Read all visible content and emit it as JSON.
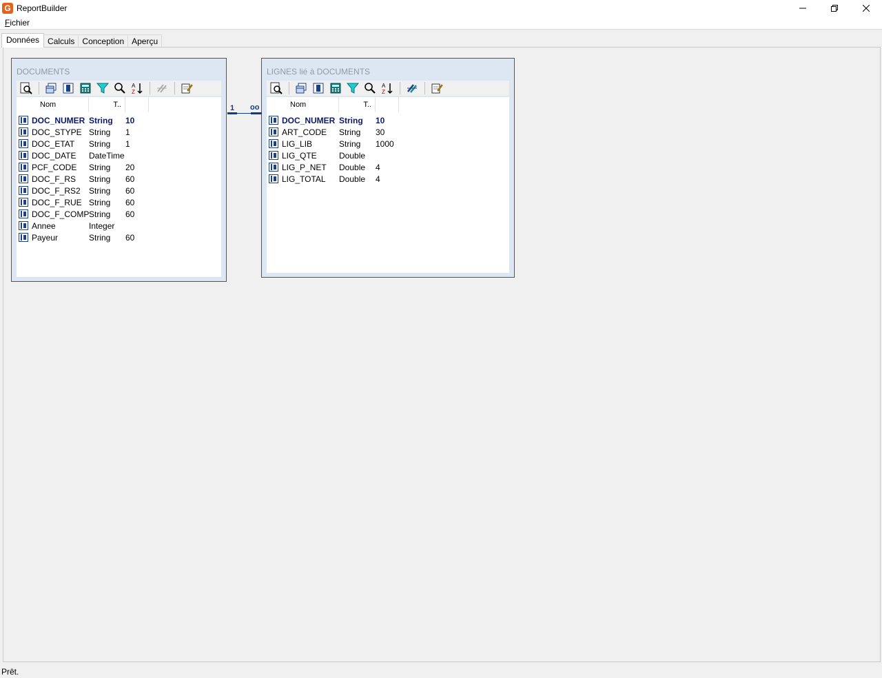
{
  "window": {
    "title": "ReportBuilder",
    "logo_letter": "G"
  },
  "menu": {
    "fichier_mnemonic": "F",
    "fichier_rest": "ichier"
  },
  "tabs": [
    {
      "label": "Données",
      "active": true
    },
    {
      "label": "Calculs",
      "active": false
    },
    {
      "label": "Conception",
      "active": false
    },
    {
      "label": "Aperçu",
      "active": false
    }
  ],
  "tables": {
    "documents": {
      "title": "DOCUMENTS",
      "col_name": "Nom",
      "col_type": "T..",
      "fields": [
        {
          "name": "DOC_NUMER",
          "type": "String",
          "size": "10",
          "pk": true
        },
        {
          "name": "DOC_STYPE",
          "type": "String",
          "size": "1"
        },
        {
          "name": "DOC_ETAT",
          "type": "String",
          "size": "1"
        },
        {
          "name": "DOC_DATE",
          "type": "DateTime",
          "size": ""
        },
        {
          "name": "PCF_CODE",
          "type": "String",
          "size": "20"
        },
        {
          "name": "DOC_F_RS",
          "type": "String",
          "size": "60"
        },
        {
          "name": "DOC_F_RS2",
          "type": "String",
          "size": "60"
        },
        {
          "name": "DOC_F_RUE",
          "type": "String",
          "size": "60"
        },
        {
          "name": "DOC_F_COMP",
          "type": "String",
          "size": "60"
        },
        {
          "name": "Annee",
          "type": "Integer",
          "size": ""
        },
        {
          "name": "Payeur",
          "type": "String",
          "size": "60"
        }
      ]
    },
    "lignes": {
      "title": "LIGNES lié à DOCUMENTS",
      "col_name": "Nom",
      "col_type": "T..",
      "fields": [
        {
          "name": "DOC_NUMER",
          "type": "String",
          "size": "10",
          "pk": true
        },
        {
          "name": "ART_CODE",
          "type": "String",
          "size": "30"
        },
        {
          "name": "LIG_LIB",
          "type": "String",
          "size": "1000"
        },
        {
          "name": "LIG_QTE",
          "type": "Double",
          "size": ""
        },
        {
          "name": "LIG_P_NET",
          "type": "Double",
          "size": "4"
        },
        {
          "name": "LIG_TOTAL",
          "type": "Double",
          "size": "4"
        }
      ]
    }
  },
  "relation": {
    "one": "1",
    "many": "oo"
  },
  "status": {
    "text": "Prêt."
  },
  "colors": {
    "accent": "#123a8a",
    "header_title": "#8f9aa6",
    "logo": "#e8611a"
  }
}
